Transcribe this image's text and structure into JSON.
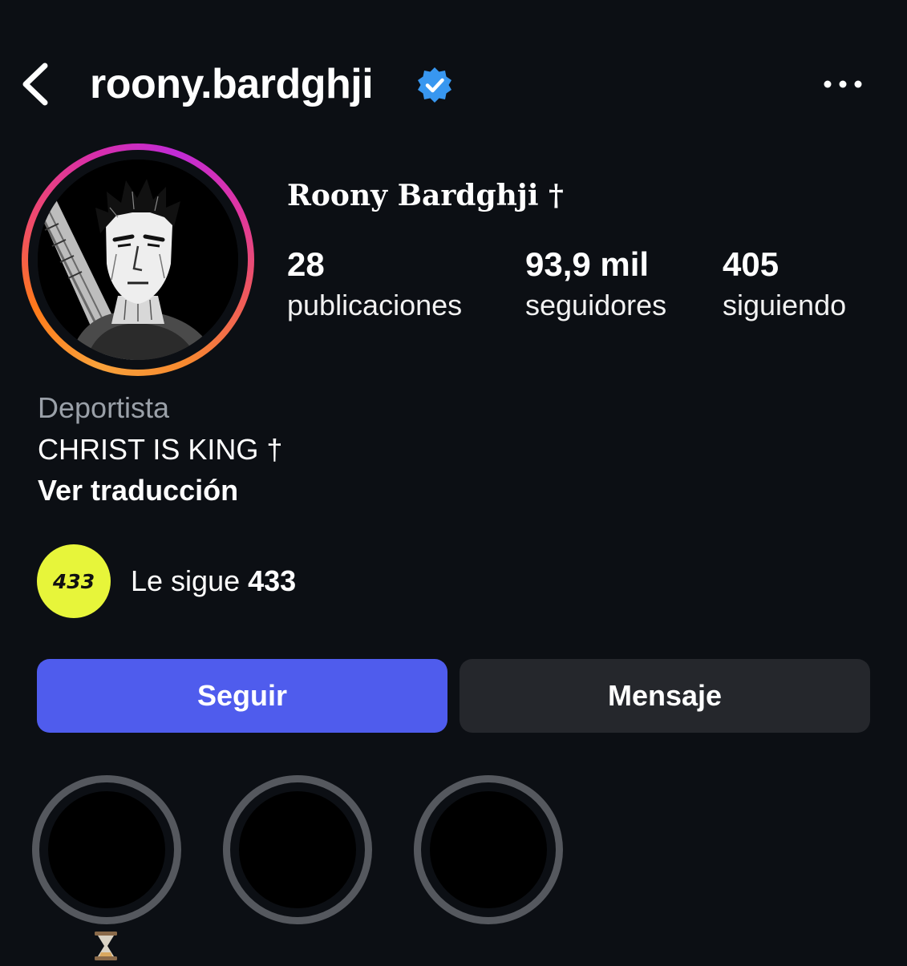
{
  "header": {
    "username": "roony.bardghji",
    "verified": true
  },
  "profile": {
    "display_name": "Roony Bardghji †",
    "stats": [
      {
        "value": "28",
        "label": "publicaciones"
      },
      {
        "value": "93,9 mil",
        "label": "seguidores"
      },
      {
        "value": "405",
        "label": "siguiendo"
      }
    ],
    "category": "Deportista",
    "bio": "CHRIST IS KING †",
    "translate_label": "Ver traducción"
  },
  "followed_by": {
    "prefix": "Le sigue ",
    "name": "433",
    "avatar_text": "433",
    "avatar_color": "#e7f53a"
  },
  "buttons": {
    "follow": "Seguir",
    "message": "Mensaje"
  },
  "colors": {
    "background": "#0c0f14",
    "follow_button": "#4f5ced",
    "message_button": "#25272c",
    "verified_badge": "#3897f0"
  },
  "highlights_count": 3,
  "icons": [
    "chevron-left-icon",
    "verified-badge-icon",
    "more-options-icon",
    "hourglass-icon"
  ]
}
